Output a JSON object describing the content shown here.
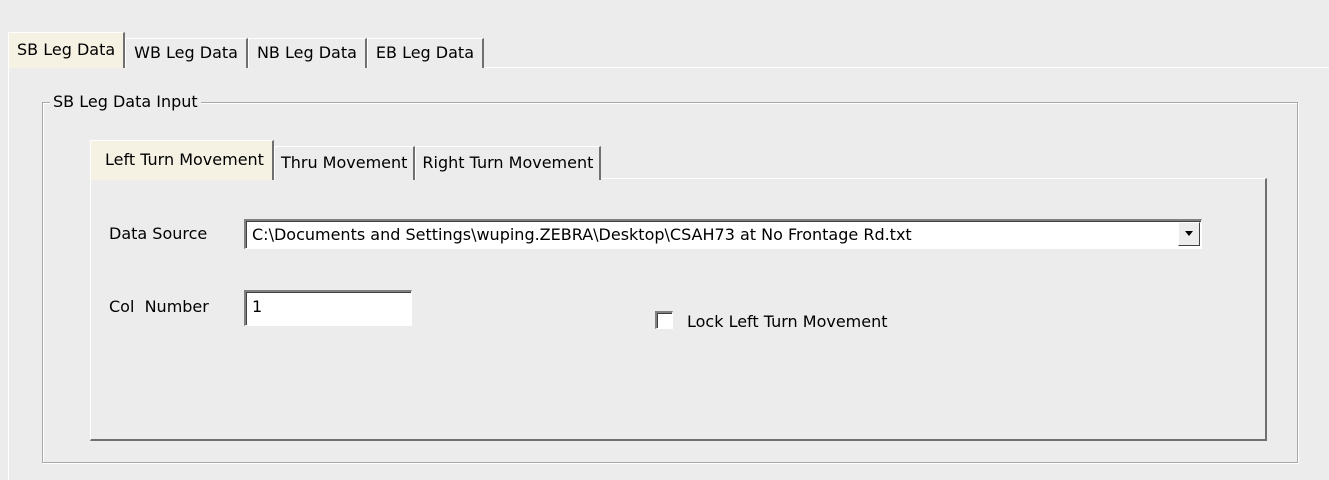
{
  "outer_tabs": [
    "SB Leg Data",
    "WB Leg Data",
    "NB Leg Data",
    "EB Leg Data"
  ],
  "outer_active": "SB Leg Data",
  "group": {
    "title": "SB Leg  Data Input"
  },
  "inner_tabs": [
    "Left Turn Movement",
    "Thru Movement",
    "Right Turn Movement"
  ],
  "inner_active": "Left Turn Movement",
  "data_source": {
    "label": "Data Source",
    "value": "C:\\Documents and Settings\\wuping.ZEBRA\\Desktop\\CSAH73 at No Frontage Rd.txt",
    "dropdown_icon": "triangle-down-icon"
  },
  "col_number": {
    "label": "Col  Number",
    "value": "1"
  },
  "lock": {
    "label": "Lock Left Turn Movement",
    "checked": false
  },
  "colors": {
    "face": "#ececec",
    "active_tab": "#f5f2e4",
    "shadow": "#707070"
  }
}
